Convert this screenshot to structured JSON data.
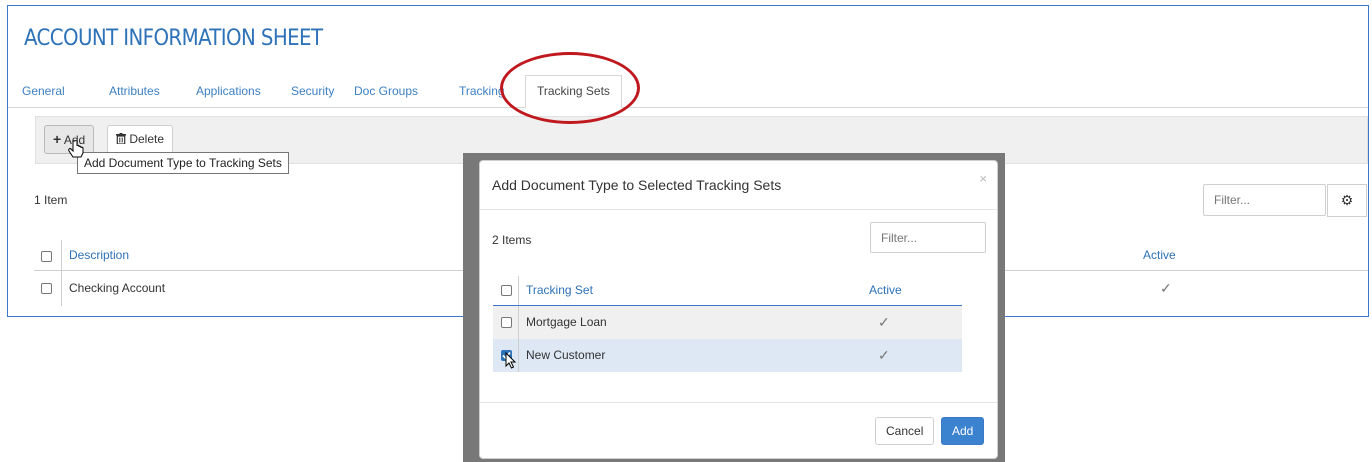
{
  "page": {
    "title": "ACCOUNT INFORMATION SHEET",
    "tabs": [
      {
        "label": "General"
      },
      {
        "label": "Attributes"
      },
      {
        "label": "Applications"
      },
      {
        "label": "Security"
      },
      {
        "label": "Doc Groups"
      },
      {
        "label": "Tracking"
      },
      {
        "label": "Tracking Sets"
      }
    ],
    "toolbar": {
      "add_label": "Add",
      "delete_label": "Delete"
    },
    "tooltip": "Add Document Type to Tracking Sets",
    "item_count": "1 Item",
    "filter_placeholder": "Filter...",
    "table": {
      "columns": [
        "Description",
        "Active"
      ],
      "rows": [
        {
          "description": "Checking Account",
          "active": "✓"
        }
      ]
    }
  },
  "modal": {
    "title": "Add Document Type to Selected Tracking Sets",
    "close": "×",
    "item_count": "2 Items",
    "filter_placeholder": "Filter...",
    "columns": [
      "Tracking Set",
      "Active"
    ],
    "rows": [
      {
        "name": "Mortgage Loan",
        "active": "✓",
        "checked": false
      },
      {
        "name": "New Customer",
        "active": "✓",
        "checked": true
      }
    ],
    "cancel_label": "Cancel",
    "add_label": "Add"
  },
  "colors": {
    "accent": "#2e72b8",
    "annotation": "#c0181f",
    "primary_button": "#3b82cf"
  }
}
